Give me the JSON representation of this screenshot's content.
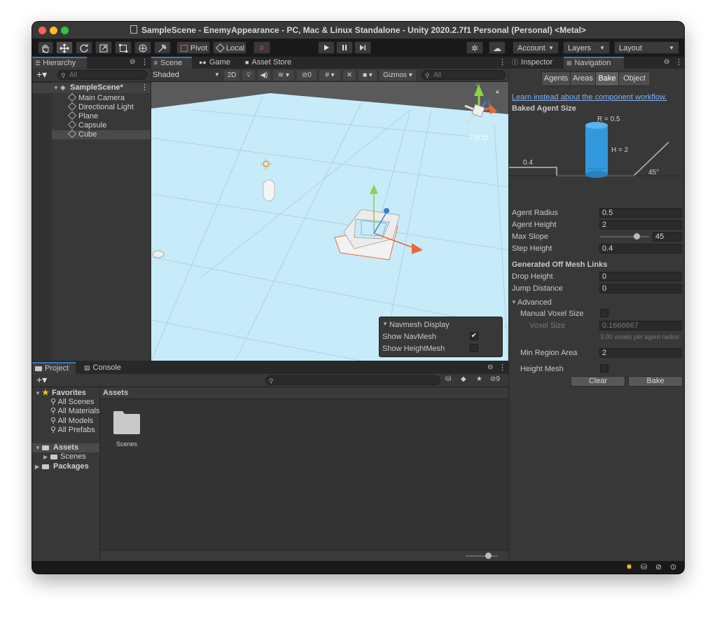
{
  "window": {
    "title": "SampleScene - EnemyAppearance - PC, Mac & Linux Standalone - Unity 2020.2.7f1 Personal (Personal) <Metal>",
    "traffic_colors": [
      "#fe5f57",
      "#febc2e",
      "#28c840"
    ]
  },
  "toolbar": {
    "pivot_label": "Pivot",
    "local_label": "Local",
    "account_label": "Account",
    "layers_label": "Layers",
    "layout_label": "Layout",
    "tool_icons": [
      "hand-icon",
      "move-icon",
      "rotate-icon",
      "scale-icon",
      "rect-icon",
      "transform-icon",
      "custom-tool-icon"
    ],
    "play_icon": "play-icon",
    "pause_icon": "pause-icon",
    "step_icon": "step-icon"
  },
  "hierarchy": {
    "tab_label": "Hierarchy",
    "search_placeholder": "All",
    "scene_name": "SampleScene*",
    "items": [
      {
        "label": "Main Camera"
      },
      {
        "label": "Directional Light"
      },
      {
        "label": "Plane"
      },
      {
        "label": "Capsule"
      },
      {
        "label": "Cube",
        "selected": true
      }
    ]
  },
  "scene_view": {
    "tabs": [
      {
        "label": "Scene",
        "active": true
      },
      {
        "label": "Game"
      },
      {
        "label": "Asset Store"
      }
    ],
    "shading_mode": "Shaded",
    "toggle_2d": "2D",
    "hidden_count": "0",
    "gizmos_label": "Gizmos",
    "search_placeholder": "All",
    "perspective_label": "Persp",
    "axis_labels": {
      "y": "y",
      "z": "z"
    },
    "sky_color": "#c8ebfa",
    "ground_color": "#5a5a5a"
  },
  "navmesh_display": {
    "title": "Navmesh Display",
    "show_navmesh_label": "Show NavMesh",
    "show_navmesh_checked": true,
    "show_heightmesh_label": "Show HeightMesh",
    "show_heightmesh_checked": false
  },
  "project": {
    "tabs": [
      {
        "label": "Project",
        "active": true
      },
      {
        "label": "Console"
      }
    ],
    "hidden_count": "9",
    "favorites_label": "Favorites",
    "favorites": [
      "All Scenes",
      "All Materials",
      "All Models",
      "All Prefabs"
    ],
    "assets_label": "Assets",
    "assets_children": [
      "Scenes"
    ],
    "packages_label": "Packages",
    "breadcrumb": "Assets",
    "grid_items": [
      {
        "label": "Scenes",
        "icon": "folder-icon"
      }
    ],
    "zoom_slider": 0.7
  },
  "inspector": {
    "tabs": [
      {
        "label": "Inspector"
      },
      {
        "label": "Navigation",
        "active": true
      }
    ],
    "segments": [
      {
        "label": "Agents"
      },
      {
        "label": "Areas"
      },
      {
        "label": "Bake",
        "active": true
      },
      {
        "label": "Object"
      }
    ],
    "workflow_link": "Learn instead about the component workflow.",
    "baked_agent_size_heading": "Baked Agent Size",
    "diagram": {
      "radius_label": "R = 0.5",
      "height_label": "H = 2",
      "step_label": "0.4",
      "slope_label": "45°",
      "cylinder_color": "#3399dd"
    },
    "agent_radius_label": "Agent Radius",
    "agent_radius_value": "0.5",
    "agent_height_label": "Agent Height",
    "agent_height_value": "2",
    "max_slope_label": "Max Slope",
    "max_slope_value": "45",
    "max_slope_fraction": 0.75,
    "step_height_label": "Step Height",
    "step_height_value": "0.4",
    "off_mesh_heading": "Generated Off Mesh Links",
    "drop_height_label": "Drop Height",
    "drop_height_value": "0",
    "jump_distance_label": "Jump Distance",
    "jump_distance_value": "0",
    "advanced_label": "Advanced",
    "manual_voxel_label": "Manual Voxel Size",
    "manual_voxel_checked": false,
    "voxel_size_label": "Voxel Size",
    "voxel_size_value": "0.1666667",
    "voxel_hint": "3.00 voxels per agent radius",
    "min_region_label": "Min Region Area",
    "min_region_value": "2",
    "height_mesh_label": "Height Mesh",
    "height_mesh_checked": false,
    "clear_label": "Clear",
    "bake_label": "Bake"
  },
  "accent_color": "#3a79bb"
}
